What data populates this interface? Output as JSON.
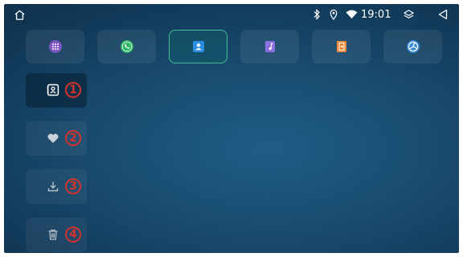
{
  "status_bar": {
    "time": "19:01",
    "icons": [
      "home-icon",
      "bluetooth-icon",
      "location-icon",
      "wifi-icon",
      "layers-icon",
      "back-icon"
    ]
  },
  "app_tabs": [
    {
      "name": "dialpad",
      "icon": "dialpad-icon",
      "color": "#7e57c2",
      "active": false
    },
    {
      "name": "phone",
      "icon": "phone-icon",
      "color": "#2fb566",
      "active": false
    },
    {
      "name": "contacts",
      "icon": "contacts-icon",
      "color": "#2b8de0",
      "active": true
    },
    {
      "name": "music",
      "icon": "music-icon",
      "color": "#8c6fe0",
      "active": false
    },
    {
      "name": "phone-transfer",
      "icon": "phone-transfer-icon",
      "color": "#f08a3c",
      "active": false
    },
    {
      "name": "connectivity",
      "icon": "connectivity-icon",
      "color": "#3a8ad6",
      "active": false
    }
  ],
  "side_menu": [
    {
      "icon": "contacts-icon",
      "badge": "1",
      "active": true
    },
    {
      "icon": "heart-icon",
      "badge": "2",
      "active": false
    },
    {
      "icon": "download-icon",
      "badge": "3",
      "active": false
    },
    {
      "icon": "trash-icon",
      "badge": "4",
      "active": false
    }
  ],
  "colors": {
    "active_tab_border": "#3fbf93",
    "badge": "#d0332e",
    "background": "#194c70"
  }
}
